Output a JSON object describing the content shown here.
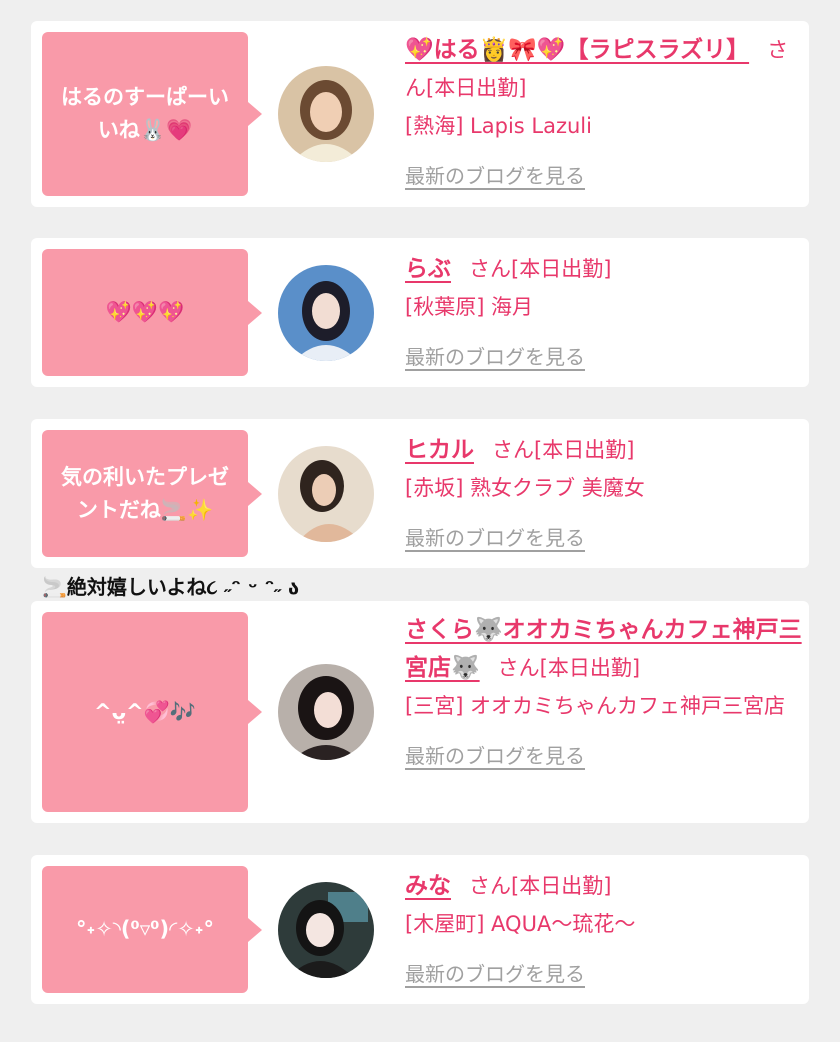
{
  "cards": [
    {
      "message": "はるのすーぱーいいね🐰💗",
      "name": "💖はる👸🎀💖【ラピスラズリ】",
      "san": "さん[本日出勤]",
      "shop": "[熱海] Lapis Lazuli",
      "blog_link": "最新のブログを見る"
    },
    {
      "message": "💖💖💖",
      "name": "らぶ",
      "san": "さん[本日出勤]",
      "shop": "[秋葉原] 海月",
      "blog_link": "最新のブログを見る"
    },
    {
      "message": "気の利いたプレゼントだね🚬✨",
      "name": "ヒカル",
      "san": "さん[本日出勤]",
      "shop": "[赤坂] 熟女クラブ 美魔女",
      "blog_link": "最新のブログを見る"
    },
    {
      "message": "^ᴗ̤^💞🎶",
      "name": "さくら🐺オオカミちゃんカフェ神戸三宮店🐺",
      "san": "さん[本日出勤]",
      "shop": "[三宮] オオカミちゃんカフェ神戸三宮店",
      "blog_link": "最新のブログを見る"
    },
    {
      "message": "°˖✧◝(⁰▿⁰)◜✧˖°",
      "name": "みな",
      "san": "さん[本日出勤]",
      "shop": "[木屋町] AQUA〜琉花〜",
      "blog_link": "最新のブログを見る"
    }
  ],
  "caption": "🚬絶対嬉しいよね૮ ˶ᵔ ᵕ ᵔ˶ ა",
  "colors": {
    "page_bg": "#efefef",
    "card_bg": "#ffffff",
    "bubble_bg": "#f99aa9",
    "name_pink": "#e8386b",
    "link_gray": "#a0a0a0"
  }
}
